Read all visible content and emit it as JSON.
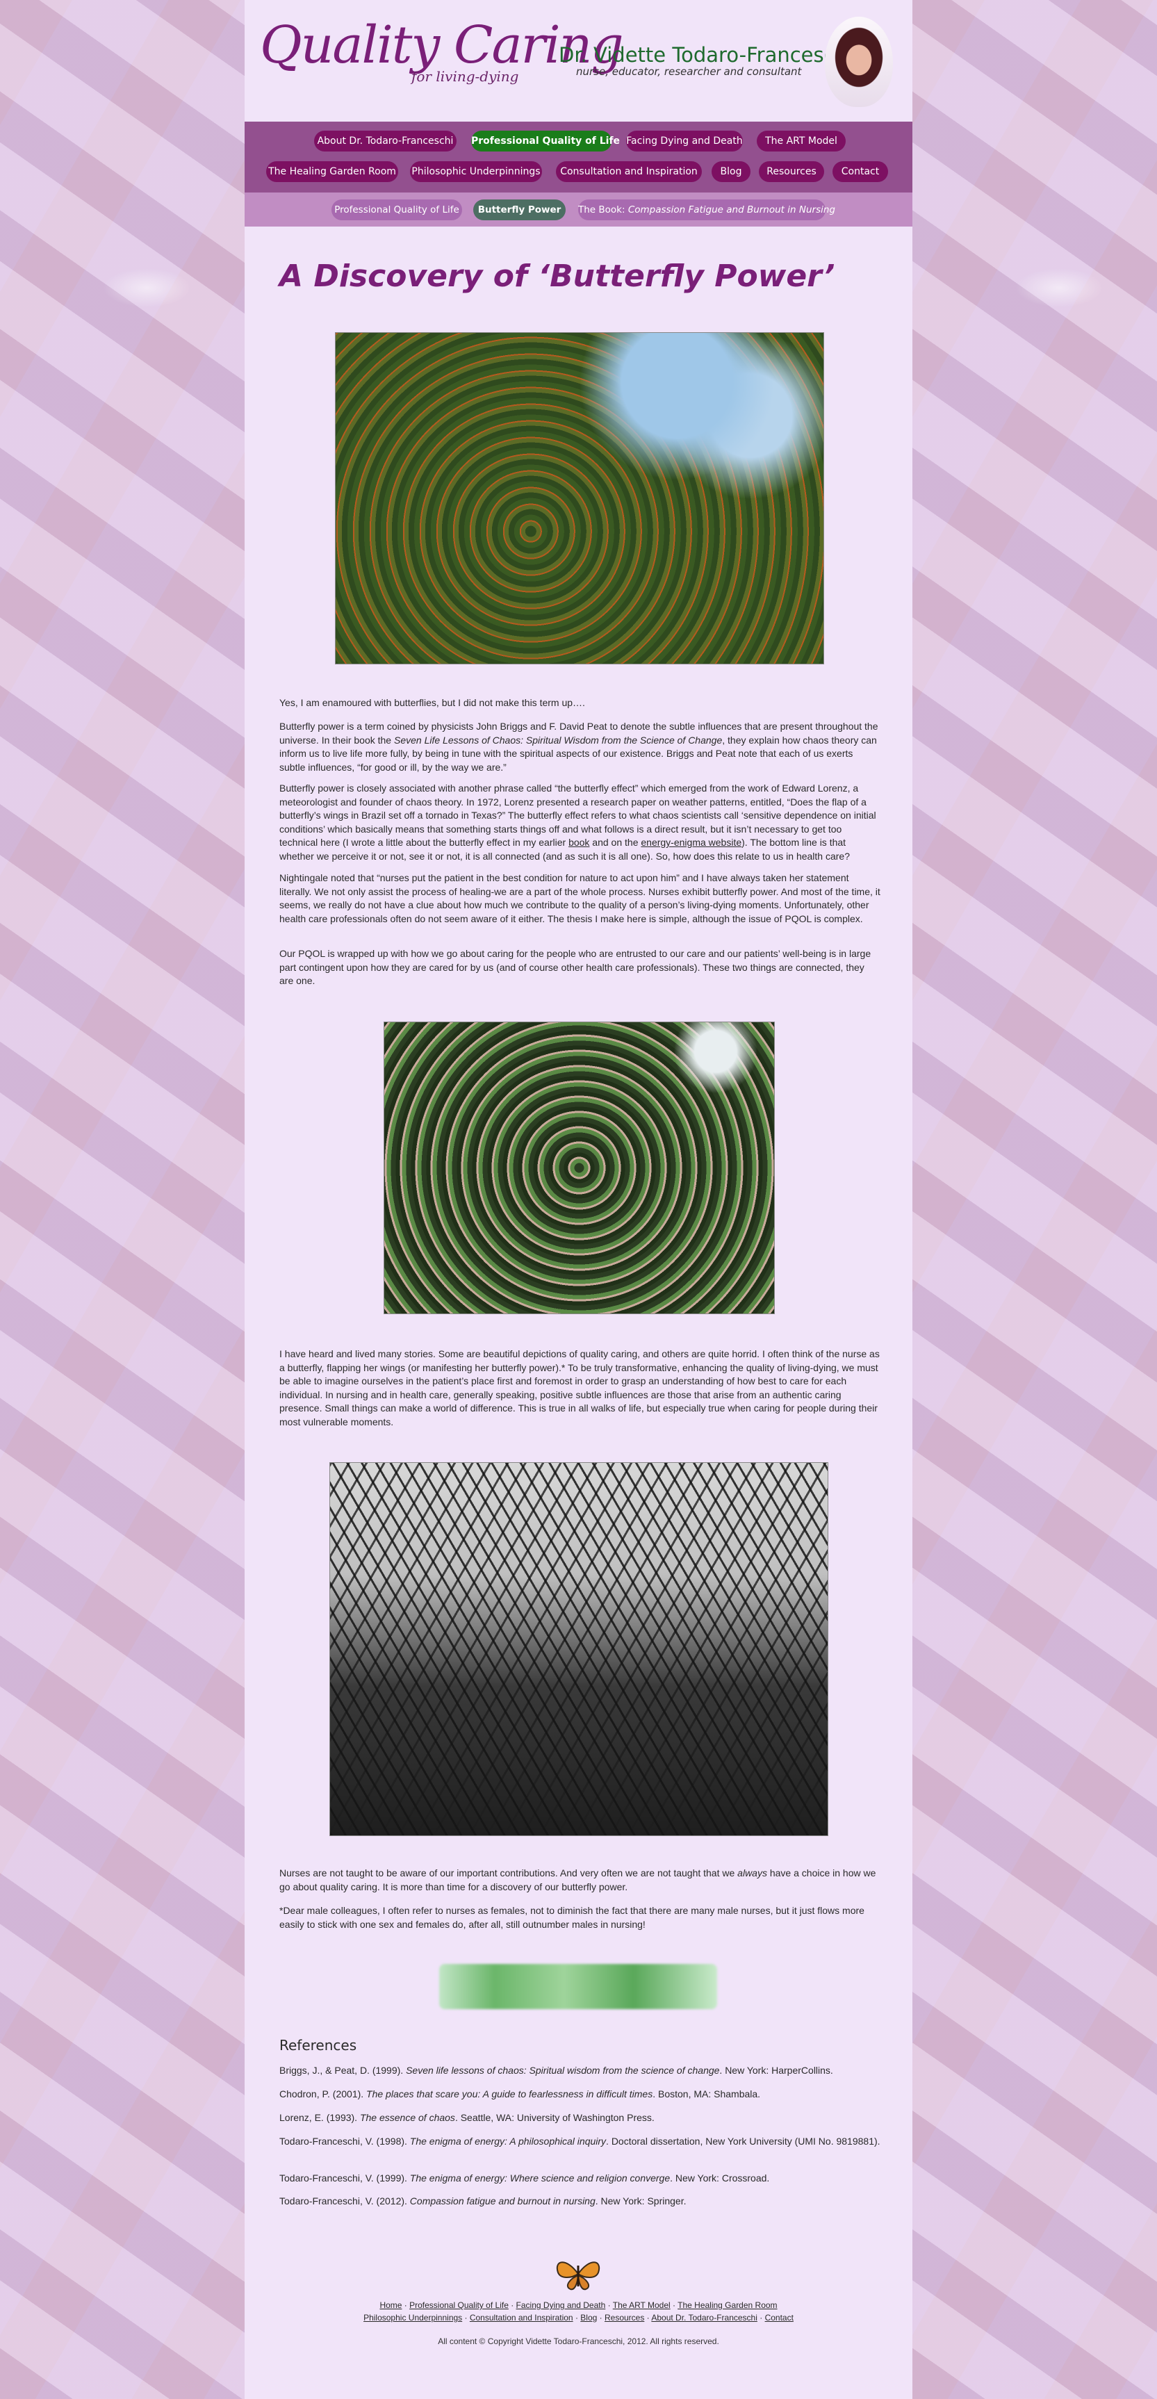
{
  "site": {
    "title": "Quality Caring",
    "subtitle": "for living-dying",
    "author_name": "Dr. Vidette Todaro-Franceschi",
    "author_tagline": "nurse, educator, researcher and consultant"
  },
  "nav": {
    "row1": [
      "About Dr. Todaro-Franceschi",
      "Professional Quality of Life",
      "Facing Dying and Death",
      "The ART Model"
    ],
    "row2": [
      "The Healing Garden Room",
      "Philosophic Underpinnings",
      "Consultation and Inspiration",
      "Blog",
      "Resources",
      "Contact"
    ],
    "active": "Professional Quality of Life"
  },
  "subnav": {
    "item1": "Professional Quality of Life",
    "item2": "Butterfly Power",
    "item3_prefix": "The Book: ",
    "item3_title": "Compassion Fatigue and Burnout in Nursing",
    "active": "Butterfly Power"
  },
  "main": {
    "title": "A Discovery of ‘Butterfly Power’",
    "p1": "Yes, I am enamoured with butterflies, but I did not make this term up….",
    "p2a": "Butterfly power is a term coined by physicists John Briggs and F. David Peat to denote the subtle influences that are present throughout the universe. In their book the ",
    "p2_em": "Seven Life Lessons of Chaos: Spiritual Wisdom from the Science of Change",
    "p2b": ", they explain how chaos theory can inform us to live life more fully, by being in tune with the spiritual aspects of our existence. Briggs and Peat note that each of us exerts subtle influences, “for good or ill, by the way we are.”",
    "p3a": "Butterfly power is closely associated with another phrase called “the butterfly effect” which emerged from the work of Edward Lorenz, a meteorologist and founder of chaos theory. In 1972, Lorenz presented a research paper on weather patterns, entitled, “Does the flap of a butterfly’s wings in Brazil set off a tornado in Texas?” The butterfly effect refers to what chaos scientists call ‘sensitive dependence on initial conditions’ which basically means that something starts things off and what follows is a direct result, but it isn’t necessary to get too technical here (I wrote a little about the butterfly effect in my earlier ",
    "p3_link1": "book",
    "p3b": " and on the ",
    "p3_link2": "energy-enigma website",
    "p3c": "). The bottom line is that whether we perceive it or not, see it or not, it is all connected (and as such it is all one). So, how does this relate to us in health care?",
    "p4": "Nightingale noted that “nurses put the patient in the best condition for nature to act upon him” and I have always taken her statement literally. We not only assist the process of healing-we are a part of the whole process. Nurses exhibit butterfly power. And most of the time, it seems, we really do not have a clue about how much we contribute to the quality of a person’s living-dying moments. Unfortunately, other health care professionals often do not seem aware of it either. The thesis I make here is simple, although the issue of PQOL is complex.",
    "p5": "Our PQOL is wrapped up with how we go about caring for the people who are entrusted to our care and our patients’ well-being is in large part contingent upon how they are cared for by us (and of course other health care professionals). These two things are connected, they are one.",
    "p6": "I have heard and lived many stories. Some are beautiful depictions of quality caring, and others are quite horrid. I often think of the nurse as a butterfly, flapping her wings (or manifesting her butterfly power).* To be truly transformative, enhancing the quality of living-dying, we must be able to imagine ourselves in the patient’s place first and foremost in order to grasp an understanding of how best to care for each individual. In nursing and in health care, generally speaking, positive subtle influences are those that arise from an authentic caring presence. Small things can make a world of difference. This is true in all walks of life, but especially true when caring for people during their most vulnerable moments.",
    "p7a": "Nurses are not taught to be aware of our important contributions. And very often we are not taught that we ",
    "p7_em": "always",
    "p7b": " have a choice in how we go about quality caring. It is more than time for a discovery of our butterfly power.",
    "p8": "*Dear male colleagues, I often refer to nurses as females, not to diminish the fact that there are many male nurses, but it just flows more easily to stick with one sex and females do, after all, still outnumber males in nursing!"
  },
  "references": {
    "title": "References",
    "items": [
      {
        "pre": "Briggs, J., & Peat, D. (1999). ",
        "em": "Seven life lessons of chaos: Spiritual wisdom from the science of change",
        "post": ". New York: HarperCollins."
      },
      {
        "pre": "Chodron, P. (2001). ",
        "em": "The places that scare you: A guide to fearlessness in difficult times",
        "post": ". Boston, MA: Shambala."
      },
      {
        "pre": "Lorenz, E. (1993). ",
        "em": "The essence of chaos",
        "post": ". Seattle, WA: University of Washington Press."
      },
      {
        "pre": "Todaro-Franceschi, V. (1998). ",
        "em": "The enigma of energy: A philosophical inquiry",
        "post": ". Doctoral dissertation, New York University (UMI No. 9819881)."
      },
      {
        "pre": "Todaro-Franceschi, V. (1999). ",
        "em": "The enigma of energy: Where science and religion converge",
        "post": ". New York: Crossroad."
      },
      {
        "pre": "Todaro-Franceschi, V. (2012). ",
        "em": "Compassion fatigue and burnout in nursing",
        "post": ". New York: Springer."
      }
    ]
  },
  "footer": {
    "line1": [
      "Home",
      "Professional Quality of Life",
      "Facing Dying and Death",
      "The ART Model",
      "The Healing Garden Room"
    ],
    "line2": [
      "Philosophic Underpinnings",
      "Consultation and Inspiration",
      "Blog",
      "Resources",
      "About Dr. Todaro-Franceschi",
      "Contact"
    ],
    "separator": " · ",
    "copyright": "All content © Copyright Vidette Todaro-Franceschi, 2012. All rights reserved."
  }
}
